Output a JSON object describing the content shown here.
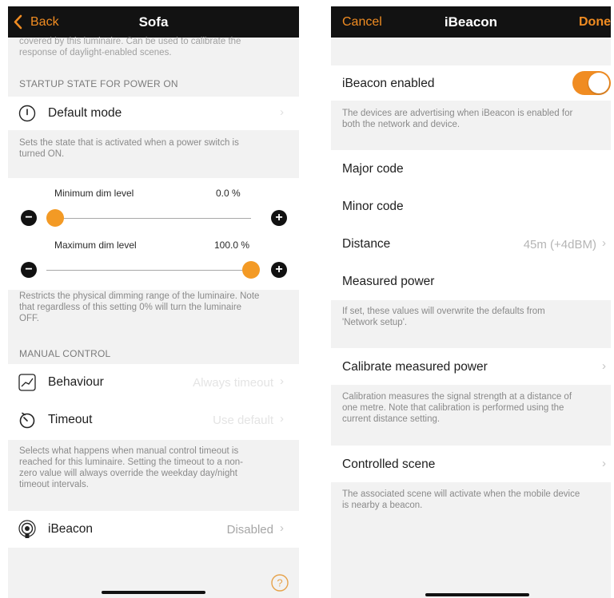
{
  "left": {
    "nav": {
      "back_label": "Back",
      "title": "Sofa"
    },
    "top_note": [
      "covered by this luminaire. Can be used to calibrate the",
      "response of daylight-enabled scenes."
    ],
    "startup_header": "STARTUP STATE FOR POWER ON",
    "default_mode": {
      "label": "Default mode"
    },
    "startup_note": [
      "Sets the state that is activated when a power switch is",
      "turned ON."
    ],
    "min_dim": {
      "label": "Minimum dim level",
      "value": "0.0 %",
      "level": 0.0
    },
    "max_dim": {
      "label": "Maximum dim level",
      "value": "100.0 %",
      "level": 1.0
    },
    "dim_note": [
      "Restricts the physical dimming range of the luminaire. Note",
      "that regardless of this setting 0% will turn the luminaire",
      "OFF."
    ],
    "manual_header": "MANUAL CONTROL",
    "behaviour": {
      "label": "Behaviour",
      "value": "Always timeout"
    },
    "timeout": {
      "label": "Timeout",
      "value": "Use default"
    },
    "manual_note": [
      "Selects what happens when manual control timeout is",
      "reached for this luminaire. Setting the timeout to a non-",
      "zero value will always override the weekday day/night",
      "timeout intervals."
    ],
    "ibeacon": {
      "label": "iBeacon",
      "value": "Disabled"
    },
    "help_icon": "help-icon"
  },
  "right": {
    "nav": {
      "cancel_label": "Cancel",
      "title": "iBeacon",
      "done_label": "Done"
    },
    "enabled": {
      "label": "iBeacon enabled",
      "on": true
    },
    "enabled_note": [
      "The devices are advertising when iBeacon is enabled for",
      "both the network and device."
    ],
    "major_code": {
      "label": "Major code"
    },
    "minor_code": {
      "label": "Minor code"
    },
    "distance": {
      "label": "Distance",
      "value": "45m (+4dBM)"
    },
    "measured_power": {
      "label": "Measured power"
    },
    "codes_note": [
      "If set, these values will overwrite the defaults from",
      "'Network setup'."
    ],
    "calibrate": {
      "label": "Calibrate measured power"
    },
    "calibrate_note": [
      "Calibration measures the signal strength at a distance of",
      "one metre. Note that calibration is performed using the",
      "current distance setting."
    ],
    "controlled_scene": {
      "label": "Controlled scene"
    },
    "scene_note": [
      "The associated scene will activate when the mobile device",
      "is nearby a beacon."
    ]
  },
  "colors": {
    "accent": "#f08c22",
    "navbar": "#121212",
    "group_bg": "#f2f2f2"
  },
  "icons": {
    "chevron": "›",
    "back": "‹"
  }
}
